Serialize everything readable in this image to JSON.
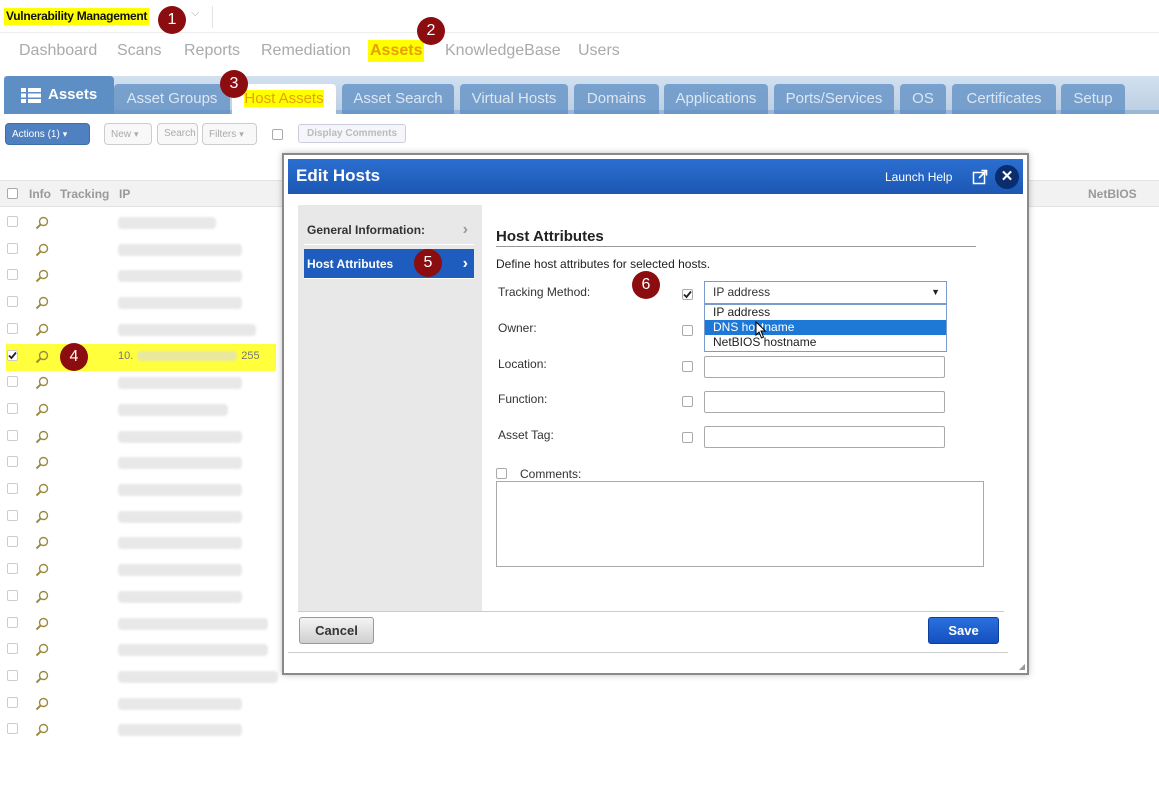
{
  "module": {
    "name": "Vulnerability Management"
  },
  "nav": [
    "Dashboard",
    "Scans",
    "Reports",
    "Remediation",
    "Assets",
    "KnowledgeBase",
    "Users"
  ],
  "tabs": {
    "title": "Assets",
    "items": [
      "Asset Groups",
      "Host Assets",
      "Asset Search",
      "Virtual Hosts",
      "Domains",
      "Applications",
      "Ports/Services",
      "OS",
      "Certificates",
      "Setup"
    ]
  },
  "toolbar": {
    "actions": "Actions (1)",
    "new": "New",
    "search": "Search",
    "filters": "Filters",
    "display_comments": "Display Comments"
  },
  "list": {
    "headers": {
      "info": "Info",
      "tracking": "Tracking",
      "ip": "IP",
      "netbios": "NetBIOS"
    },
    "selected_ip_prefix": "10.",
    "selected_ip_suffix": "255"
  },
  "dialog": {
    "title": "Edit Hosts",
    "help": "Launch Help",
    "close": "✕",
    "sidebar": [
      "General Information:",
      "Host Attributes"
    ],
    "section_title": "Host Attributes",
    "section_desc": "Define host attributes for selected hosts.",
    "fields": {
      "tracking": "Tracking Method:",
      "owner": "Owner:",
      "location": "Location:",
      "function": "Function:",
      "asset_tag": "Asset Tag:",
      "comments": "Comments:"
    },
    "tracking_value": "IP address",
    "tracking_options": [
      "IP address",
      "DNS hostname",
      "NetBIOS hostname"
    ],
    "cancel": "Cancel",
    "save": "Save"
  },
  "badges": [
    "1",
    "2",
    "3",
    "4",
    "5",
    "6"
  ]
}
